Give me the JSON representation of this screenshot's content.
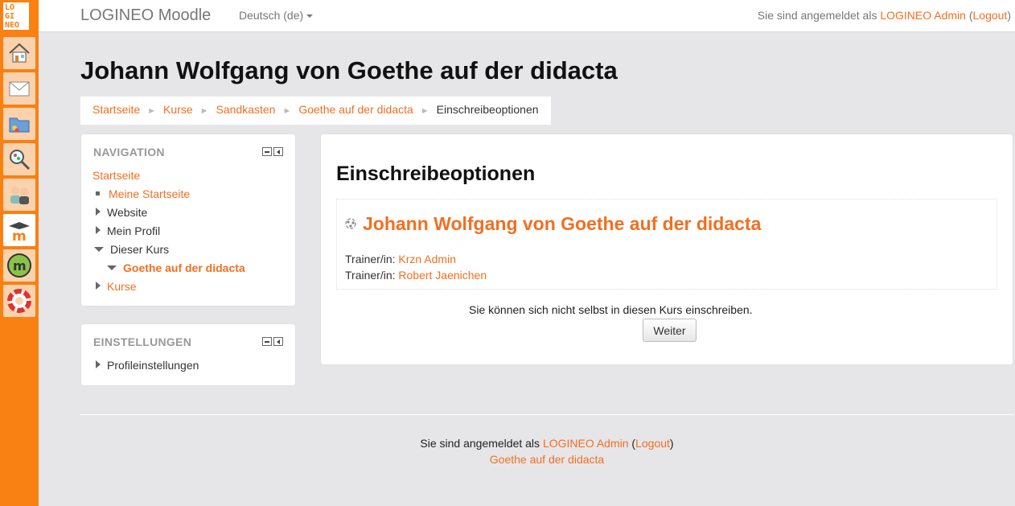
{
  "dock": {
    "logo_text": "LOGINEO",
    "items": [
      "home-icon",
      "mail-icon",
      "folder-icon",
      "search-icon",
      "users-icon",
      "moodle-icon",
      "moodle-m-icon",
      "help-icon"
    ]
  },
  "navbar": {
    "brand": "LOGINEO Moodle",
    "language": "Deutsch (de)",
    "login_prefix": "Sie sind angemeldet als ",
    "user_name": "LOGINEO Admin",
    "logout_open": " (",
    "logout_label": "Logout",
    "logout_close": ")"
  },
  "page": {
    "title": "Johann Wolfgang von Goethe auf der didacta"
  },
  "breadcrumb": {
    "items": [
      "Startseite",
      "Kurse",
      "Sandkasten",
      "Goethe auf der didacta"
    ],
    "current": "Einschreibeoptionen",
    "separator": "►"
  },
  "navigation_block": {
    "title": "NAVIGATION",
    "home": "Startseite",
    "my_home": "Meine Startseite",
    "site": "Website",
    "profile": "Mein Profil",
    "this_course": "Dieser Kurs",
    "course": "Goethe auf der didacta",
    "courses": "Kurse"
  },
  "settings_block": {
    "title": "EINSTELLUNGEN",
    "profile_settings": "Profileinstellungen"
  },
  "main": {
    "heading": "Einschreibeoptionen",
    "course_name": "Johann Wolfgang von Goethe auf der didacta",
    "teachers": [
      {
        "role": "Trainer/in: ",
        "name": "Krzn Admin"
      },
      {
        "role": "Trainer/in: ",
        "name": "Robert Jaenichen"
      }
    ],
    "notice": "Sie können sich nicht selbst in diesen Kurs einschreiben.",
    "continue_button": "Weiter"
  },
  "footer": {
    "login_prefix": "Sie sind angemeldet als ",
    "user_name": "LOGINEO Admin",
    "logout_open": " (",
    "logout_label": "Logout",
    "logout_close": ")",
    "course_link": "Goethe auf der didacta"
  },
  "colors": {
    "accent": "#f26f21",
    "dock": "#f98012"
  }
}
